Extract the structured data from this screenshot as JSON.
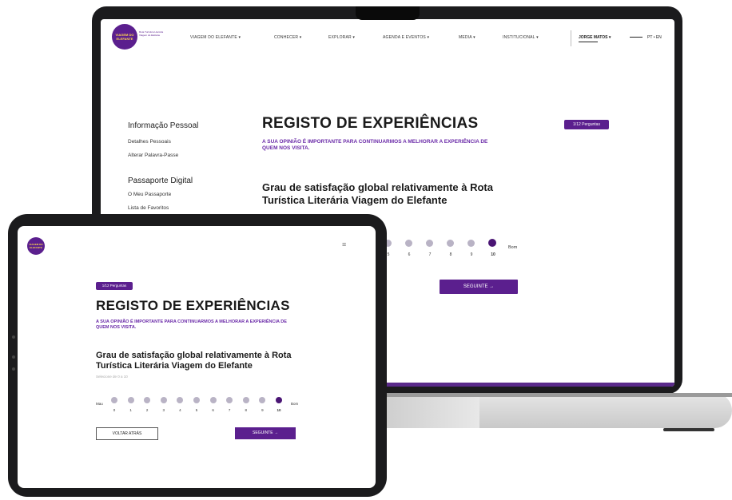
{
  "laptop": {
    "logo": {
      "name": "VIAGEM DO ELEFANTE",
      "tagline": "Rota Turística Literária Viagem do Elefante"
    },
    "nav": [
      {
        "label": "VIAGEM DO ELEFANTE ▾"
      },
      {
        "label": "CONHECER ▾"
      },
      {
        "label": "EXPLORAR ▾"
      },
      {
        "label": "AGENDA E EVENTOS ▾"
      },
      {
        "label": "MEDIA ▾"
      },
      {
        "label": "INSTITUCIONAL ▾"
      }
    ],
    "user": "JORGE MATOS ▾",
    "lang": "PT • EN",
    "sidebar": {
      "section1": "Informação Pessoal",
      "items1": [
        "Detalhes Pessoais",
        "Alterar Palavra-Passe"
      ],
      "section2": "Passaporte Digital",
      "items2": [
        "O Meu Passaporte",
        "Lista de Favoritos"
      ]
    },
    "title": "REGISTO DE EXPERIÊNCIAS",
    "subtitle": "A SUA OPINIÃO É IMPORTANTE PARA CONTINUARMOS A MELHORAR A EXPERIÊNCIA DE QUEM NOS VISITA.",
    "badge": "1/12 Perguntas",
    "question": "Grau de satisfação global relativamente à Rota Turística Literária Viagem do Elefante",
    "scale_visible": [
      "5",
      "6",
      "7",
      "8",
      "9",
      "10"
    ],
    "scale_end": "Bom",
    "next": "SEGUINTE →"
  },
  "tablet": {
    "badge": "1/12 Perguntas",
    "title": "REGISTO DE EXPERIÊNCIAS",
    "subtitle": "A SUA OPINIÃO É IMPORTANTE PARA CONTINUARMOS A MELHORAR A EXPERIÊNCIA DE QUEM NOS VISITA.",
    "question": "Grau de satisfação global relativamente à Rota Turística Literária Viagem do Elefante",
    "hint": "Selecione de 0 a 10",
    "scale": [
      "0",
      "1",
      "2",
      "3",
      "4",
      "5",
      "6",
      "7",
      "8",
      "9",
      "10"
    ],
    "scale_start": "Mau",
    "scale_end": "Bom",
    "back": "VOLTAR ATRÁS",
    "next": "SEGUINTE →"
  },
  "selected_value": 10,
  "colors": {
    "brand": "#5b1f8e",
    "accent_text": "#6a2aa8",
    "paw_inactive": "#b9b3c5"
  }
}
